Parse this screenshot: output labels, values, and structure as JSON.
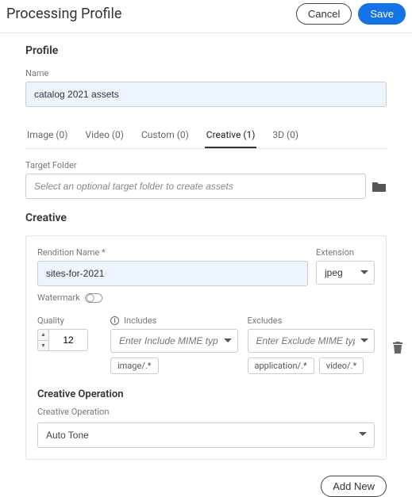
{
  "header": {
    "title": "Processing Profile",
    "cancel": "Cancel",
    "save": "Save"
  },
  "profile": {
    "section_title": "Profile",
    "name_label": "Name",
    "name_value": "catalog 2021 assets"
  },
  "tabs": [
    {
      "label": "Image (0)"
    },
    {
      "label": "Video (0)"
    },
    {
      "label": "Custom (0)"
    },
    {
      "label": "Creative (1)"
    },
    {
      "label": "3D (0)"
    }
  ],
  "target": {
    "label": "Target Folder",
    "placeholder": "Select an optional target folder to create assets"
  },
  "creative": {
    "section_title": "Creative",
    "rendition_label": "Rendition Name *",
    "rendition_value": "sites-for-2021",
    "extension_label": "Extension",
    "extension_value": "jpeg",
    "watermark_label": "Watermark",
    "quality_label": "Quality",
    "quality_value": "12",
    "includes_label": "Includes",
    "includes_placeholder": "Enter Include MIME type",
    "includes_chips": [
      "image/.*"
    ],
    "excludes_label": "Excludes",
    "excludes_placeholder": "Enter Exclude MIME type",
    "excludes_chips": [
      "application/.*",
      "video/.*"
    ],
    "op_section_title": "Creative Operation",
    "op_label": "Creative Operation",
    "op_value": "Auto Tone"
  },
  "footer": {
    "add_new": "Add New"
  }
}
